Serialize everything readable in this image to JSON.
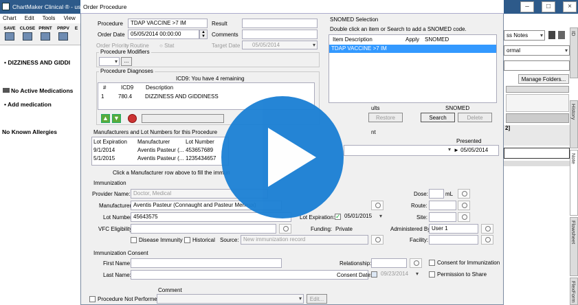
{
  "app": {
    "title": "ChartMaker Clinical ® - use",
    "menu": [
      "Chart",
      "Edit",
      "Tools",
      "View"
    ],
    "toolbar": [
      "SAVE",
      "CLOSE",
      "PRINT",
      "PRPV",
      "E"
    ],
    "left": {
      "problem": "DIZZINESS AND GIDDI",
      "meds": "No Active Medications",
      "add_med": "Add medication",
      "allergies": "No Known Allergies"
    },
    "right": {
      "notes_select": "ss Notes",
      "normal_select": "ormal",
      "manage": "Manage Folders...",
      "num": "2]",
      "tabs": [
        "ID",
        "History",
        "Note",
        "Flowsheet",
        "FlexForm"
      ]
    }
  },
  "dialog": {
    "title": "Order Procedure",
    "procedure_label": "Procedure",
    "procedure_value": "TDAP VACCINE >7 IM",
    "order_date_label": "Order Date",
    "order_date_value": "05/05/2014 00:00:00",
    "result_label": "Result",
    "comments_label": "Comments",
    "order_priority_label": "Order Priority",
    "routine_label": "Routine",
    "stat_label": "Stat",
    "target_date_label": "Target Date",
    "target_date_value": "05/05/2014",
    "modifiers_title": "Procedure Modifiers",
    "modifier_ellipsis": "...",
    "diagnoses_title": "Procedure Diagnoses",
    "icd_remaining": "ICD9: You have 4 remaining",
    "diag_headers": [
      "#",
      "ICD9",
      "Description"
    ],
    "diag_rows": [
      {
        "n": "1",
        "icd": "780.4",
        "desc": "DIZZINESS AND GIDDINESS"
      }
    ],
    "snomed": {
      "title": "SNOMED Selection",
      "hint": "Double click an item or Search to add a SNOMED code.",
      "headers": [
        "Item Description",
        "Apply",
        "SNOMED"
      ],
      "selected": "TDAP VACCINE >7 IM",
      "results_suffix": "ults",
      "snomed_label": "SNOMED",
      "restore": "Restore",
      "search": "Search",
      "delete": "Delete"
    },
    "manufacturers_title": "Manufacturers and Lot Numbers for this Procedure",
    "lot_headers": [
      "Lot Expiration",
      "Manufacturer",
      "Lot Number"
    ],
    "lots": [
      {
        "exp": "9/1/2014",
        "mfr": "Aventis Pasteur (...",
        "lot": "453657689"
      },
      {
        "exp": "5/1/2015",
        "mfr": "Aventis Pasteur (...",
        "lot": "1235434657"
      }
    ],
    "click_hint": "Click a Manufacturer row above to fill the immun",
    "vis_suffix": "nt",
    "presented_label": "Presented",
    "presented_value": "05/05/2014",
    "immunization_title": "Immunization",
    "provider_label": "Provider Name:",
    "provider_value": "Doctor, Medical",
    "manufacturer_label": "Manufacturer:",
    "manufacturer_value": "Aventis Pasteur (Connaught and Pasteur Merieux)",
    "lot_label": "Lot Number:",
    "lot_value": "45643575",
    "lot_exp_label": "Lot Expiration:",
    "lot_exp_value": "05/01/2015",
    "vfc_label": "VFC Eligibility:",
    "funding_label": "Funding:",
    "funding_value": "Private",
    "disease_immunity": "Disease Immunity",
    "historical": "Historical",
    "source_label": "Source:",
    "source_value": "New immunization record",
    "dose_label": "Dose:",
    "dose_unit": "mL",
    "route_label": "Route:",
    "site_label": "Site:",
    "admin_label": "Administered By:",
    "admin_value": "User 1",
    "facility_label": "Facility:",
    "consent_title": "Immunization Consent",
    "first_name_label": "First Name:",
    "last_name_label": "Last Name:",
    "relationship_label": "Relationship:",
    "consent_date_label": "Consent Date:",
    "consent_date_value": "09/23/2014",
    "consent_immunization": "Consent for Immunization",
    "permission_share": "Permission to Share",
    "not_performed": "Procedure Not Performed",
    "comment_label": "Comment",
    "edit": "Edit..."
  }
}
